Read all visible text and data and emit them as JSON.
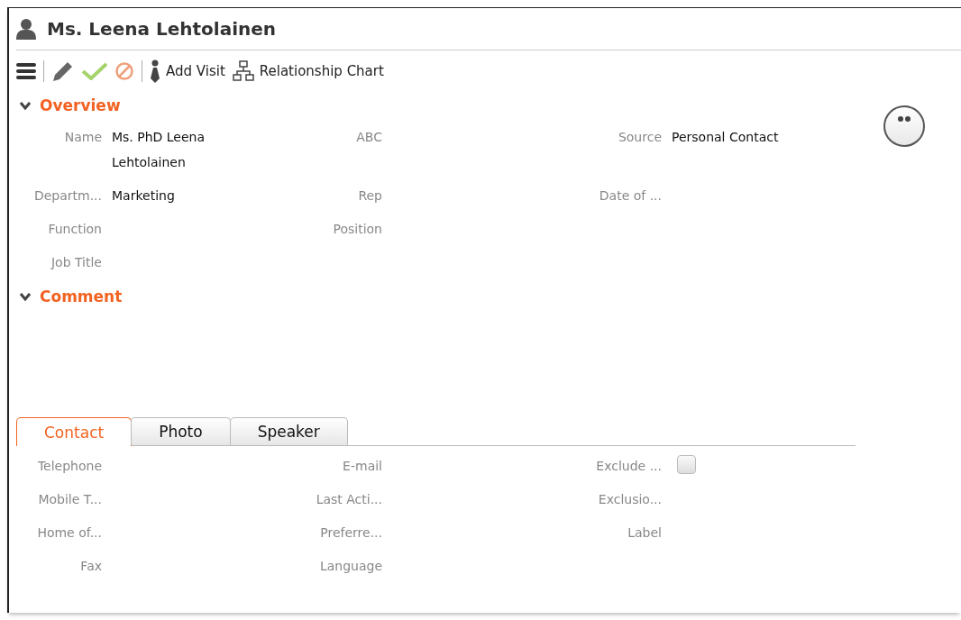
{
  "title": "Ms. Leena Lehtolainen",
  "toolbar": [
    {
      "kind": "menu"
    },
    {
      "kind": "separator"
    },
    {
      "kind": "edit"
    },
    {
      "kind": "save"
    },
    {
      "kind": "cancel"
    },
    {
      "kind": "separator"
    },
    {
      "kind": "visit",
      "label": "Add Visit"
    },
    {
      "kind": "chart",
      "label": "Relationship Chart"
    }
  ],
  "sections": [
    {
      "title": "Overview",
      "expanded": true,
      "rows": [
        {
          "cells": [
            {
              "label": "Name",
              "value": "Ms. PhD Leena Lehtolainen"
            },
            {
              "label": "ABC"
            },
            {
              "label": "Source",
              "value": "Personal Contact"
            }
          ]
        },
        {
          "cells": [
            {
              "label": "Departm...",
              "value": "Marketing"
            },
            {
              "label": "Rep"
            },
            {
              "label": "Date of ..."
            }
          ]
        },
        {
          "cells": [
            {
              "label": "Function"
            },
            {
              "label": "Position"
            }
          ]
        },
        {
          "cells": [
            {
              "label": "Job Title"
            }
          ]
        }
      ]
    },
    {
      "title": "Comment",
      "expanded": true
    }
  ],
  "tabs": [
    {
      "label": "Contact",
      "selected": true
    },
    {
      "label": "Photo",
      "selected": false
    },
    {
      "label": "Speaker",
      "selected": false
    }
  ],
  "contact_rows": [
    {
      "cells": [
        {
          "label": "Telephone"
        },
        {
          "label": "E-mail"
        },
        {
          "label": "Exclude ...",
          "kind": "checkbox",
          "checked": false
        }
      ]
    },
    {
      "cells": [
        {
          "label": "Mobile T..."
        },
        {
          "label": "Last Acti..."
        },
        {
          "label": "Exclusio..."
        }
      ]
    },
    {
      "cells": [
        {
          "label": "Home of..."
        },
        {
          "label": "Preferre..."
        },
        {
          "label": "Label"
        }
      ]
    },
    {
      "cells": [
        {
          "label": "Fax"
        },
        {
          "label": "Language"
        }
      ]
    }
  ]
}
